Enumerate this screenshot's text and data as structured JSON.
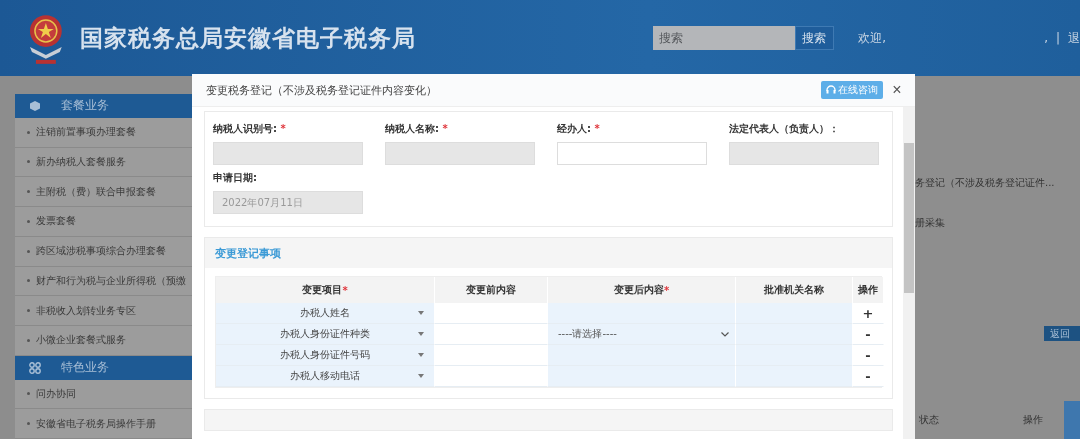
{
  "header": {
    "title": "国家税务总局安徽省电子税务局",
    "search": {
      "placeholder": "搜索",
      "button": "搜索"
    },
    "welcome": "欢迎,",
    "comma": ",",
    "separator": "|",
    "logout": "退"
  },
  "sidebar": {
    "groups": [
      {
        "title": "套餐业务",
        "items": [
          "注销前置事项办理套餐",
          "新办纳税人套餐服务",
          "主附税（费）联合申报套餐",
          "发票套餐",
          "跨区域涉税事项综合办理套餐",
          "财产和行为税与企业所得税（预缴",
          "非税收入划转业务专区",
          "小微企业套餐式服务"
        ]
      },
      {
        "title": "特色业务",
        "items": [
          "问办协同",
          "安徽省电子税务局操作手册"
        ]
      }
    ]
  },
  "modal": {
    "title": "变更税务登记（不涉及税务登记证件内容变化）",
    "consult_button": "在线咨询",
    "close": "×",
    "required_mark": "*",
    "fields": [
      {
        "label": "纳税人识别号:",
        "required": true,
        "disabled": true
      },
      {
        "label": "纳税人名称:",
        "required": true,
        "disabled": true
      },
      {
        "label": "经办人:",
        "required": true,
        "disabled": false
      },
      {
        "label": "法定代表人（负责人）：",
        "required": false,
        "disabled": true
      },
      {
        "label": "申请日期:",
        "required": false,
        "disabled": true,
        "value": "2022年07月11日"
      }
    ],
    "changes": {
      "title": "变更登记事项",
      "columns": [
        {
          "label": "变更项目",
          "required": true
        },
        {
          "label": "变更前内容",
          "required": false
        },
        {
          "label": "变更后内容",
          "required": true
        },
        {
          "label": "批准机关名称",
          "required": false
        },
        {
          "label": "操作",
          "required": false
        }
      ],
      "rows": [
        {
          "item": "办税人姓名",
          "action": "+"
        },
        {
          "item": "办税人身份证件种类",
          "after": {
            "kind": "select",
            "placeholder": "----请选择----"
          },
          "action": "-"
        },
        {
          "item": "办税人身份证件号码",
          "action": "-"
        },
        {
          "item": "办税人移动电话",
          "action": "-"
        }
      ]
    }
  },
  "background": {
    "texts": [
      "务登记（不涉及税务登记证件...",
      "册采集"
    ],
    "return_button": "返回",
    "columns": [
      "状态",
      "操作"
    ]
  }
}
